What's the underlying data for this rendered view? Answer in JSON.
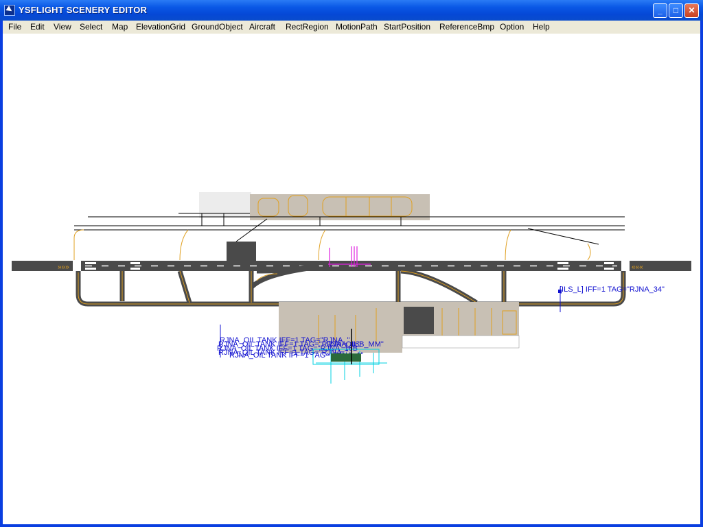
{
  "window": {
    "title": "YSFLIGHT SCENERY EDITOR"
  },
  "title_buttons": {
    "minimize": "_",
    "maximize": "□",
    "close": "✕"
  },
  "menu": [
    "File",
    "Edit",
    "View",
    "Select",
    "Map",
    "ElevationGrid",
    "GroundObject",
    "Aircraft",
    "RectRegion",
    "MotionPath",
    "StartPosition",
    "ReferenceBmp",
    "Option",
    "Help"
  ],
  "map_labels": {
    "ils": "[ILS_L] IFF=1 TAG=\"RJNA_34\"",
    "mm": "RJNA_16B_MM\"",
    "oil_tank_1": "RJNA_OIL TANK IFF=1 TAG=\"RJNA_\"",
    "oil_tank_2": "RJNA_OIL TANK IFF=1 TAG=\"RJNA_OIL\"",
    "oil_tank_3": "RJNA_OIL TANK IFF=1 TAG=\"RJNA_16B\"",
    "oil_tank_4": "RJNA_OIL TANK IFF=1 TAG=\"RJNA_\"",
    "oil_tank_5": "RJNA_OIL TANK IFF=1 TAG=\"RJNA_1\""
  },
  "colors": {
    "runway": "#4a4a4a",
    "taxi_line": "#e0a020",
    "apron": "#c8c0b4",
    "label": "#1010d0",
    "path": "#e020e0",
    "region": "#00d0e0"
  }
}
